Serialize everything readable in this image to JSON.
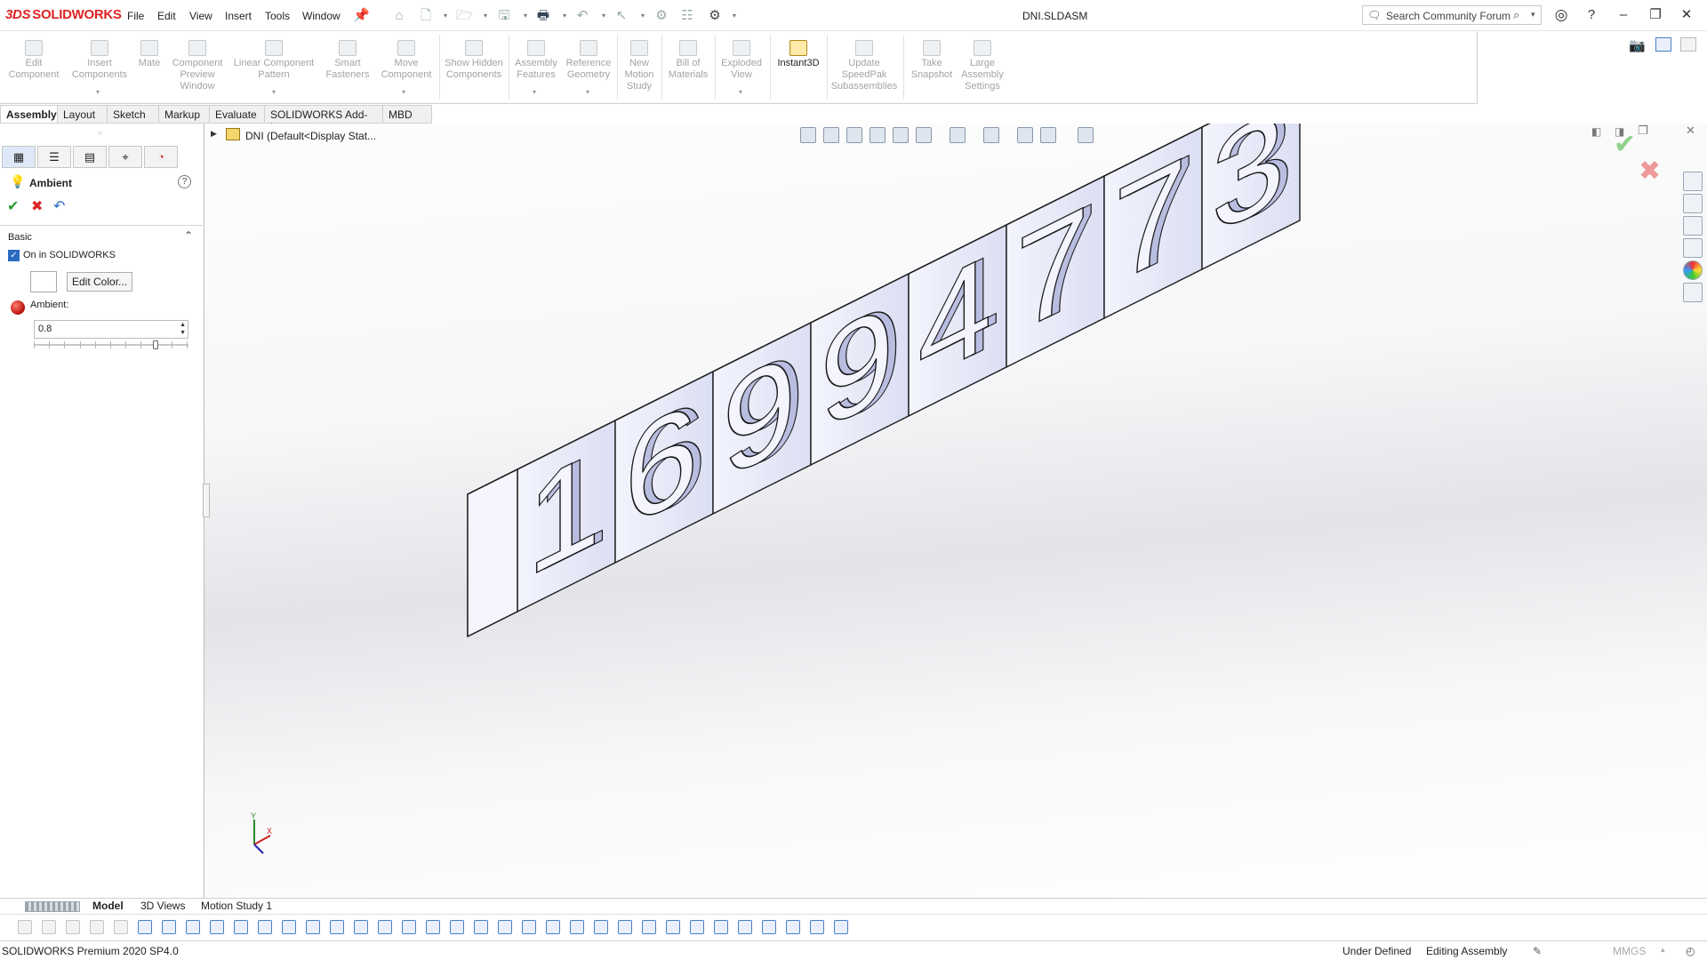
{
  "app": {
    "brand": "SOLIDWORKS",
    "brand_prefix": "3DS",
    "document_title": "DNI.SLDASM"
  },
  "menu": [
    "File",
    "Edit",
    "View",
    "Insert",
    "Tools",
    "Window"
  ],
  "search": {
    "placeholder": "Search Community Forum"
  },
  "ribbon": [
    {
      "label": "Edit Component",
      "icon": "edit-component-icon"
    },
    {
      "label": "Insert Components",
      "icon": "insert-components-icon"
    },
    {
      "label": "Mate",
      "icon": "mate-icon"
    },
    {
      "label": "Component Preview Window",
      "icon": "preview-window-icon"
    },
    {
      "label": "Linear Component Pattern",
      "icon": "linear-pattern-icon"
    },
    {
      "label": "Smart Fasteners",
      "icon": "smart-fasteners-icon"
    },
    {
      "label": "Move Component",
      "icon": "move-component-icon"
    },
    {
      "label": "Show Hidden Components",
      "icon": "show-hidden-icon"
    },
    {
      "label": "Assembly Features",
      "icon": "assembly-features-icon"
    },
    {
      "label": "Reference Geometry",
      "icon": "reference-geometry-icon"
    },
    {
      "label": "New Motion Study",
      "icon": "motion-study-icon"
    },
    {
      "label": "Bill of Materials",
      "icon": "bom-icon"
    },
    {
      "label": "Exploded View",
      "icon": "exploded-view-icon"
    },
    {
      "label": "Instant3D",
      "icon": "instant3d-icon"
    },
    {
      "label": "Update SpeedPak Subassemblies",
      "icon": "speedpak-icon"
    },
    {
      "label": "Take Snapshot",
      "icon": "snapshot-icon"
    },
    {
      "label": "Large Assembly Settings",
      "icon": "large-assembly-icon"
    }
  ],
  "command_tabs": [
    "Assembly",
    "Layout",
    "Sketch",
    "Markup",
    "Evaluate",
    "SOLIDWORKS Add-Ins",
    "MBD"
  ],
  "tree": {
    "root_label": "DNI  (Default<Display Stat..."
  },
  "property_manager": {
    "title": "Ambient",
    "section": "Basic",
    "checkbox_label": "On in SOLIDWORKS",
    "edit_color_label": "Edit Color...",
    "ambient_label": "Ambient:",
    "ambient_value": "0.8",
    "ambient_slider_fraction": 0.8
  },
  "model": {
    "digits": [
      "1",
      "6",
      "9",
      "9",
      "4",
      "7",
      "7",
      "3"
    ]
  },
  "bottom_tabs": [
    "Model",
    "3D Views",
    "Motion Study 1"
  ],
  "status": {
    "product": "SOLIDWORKS Premium 2020 SP4.0",
    "definition": "Under Defined",
    "mode": "Editing Assembly",
    "units": "MMGS"
  },
  "colors": {
    "brand": "#d22222",
    "accent": "#2c6cc0",
    "model_face_top": "#ffffff",
    "model_face_front": "#e9ebfb",
    "model_face_side": "#c9cde8"
  }
}
